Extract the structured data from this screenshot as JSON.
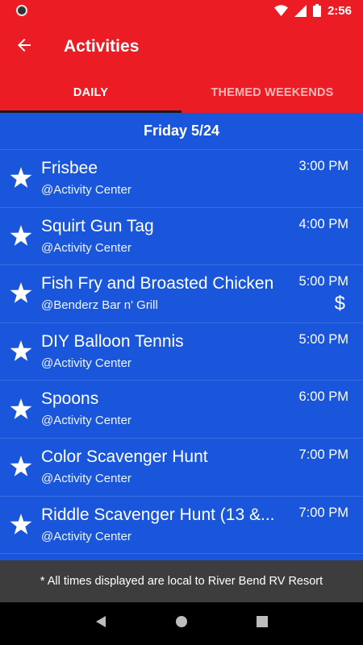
{
  "status_bar": {
    "time": "2:56",
    "icons": [
      "wifi-icon",
      "signal-icon",
      "battery-icon"
    ]
  },
  "app_bar": {
    "title": "Activities",
    "back_icon": "arrow-left-icon"
  },
  "tabs": [
    {
      "label": "DAILY",
      "active": true
    },
    {
      "label": "THEMED WEEKENDS",
      "active": false
    }
  ],
  "day_header": "Friday 5/24",
  "events": [
    {
      "name": "Frisbee",
      "location": "@Activity Center",
      "time": "3:00 PM",
      "paid": false
    },
    {
      "name": "Squirt Gun Tag",
      "location": "@Activity Center",
      "time": "4:00 PM",
      "paid": false
    },
    {
      "name": "Fish Fry and Broasted Chicken",
      "location": "@Benderz Bar n' Grill",
      "time": "5:00 PM",
      "paid": true,
      "paid_symbol": "$"
    },
    {
      "name": "DIY Balloon Tennis",
      "location": "@Activity Center",
      "time": "5:00 PM",
      "paid": false
    },
    {
      "name": "Spoons",
      "location": "@Activity Center",
      "time": "6:00 PM",
      "paid": false
    },
    {
      "name": "Color Scavenger Hunt",
      "location": "@Activity Center",
      "time": "7:00 PM",
      "paid": false
    },
    {
      "name": "Riddle Scavenger Hunt (13 &...",
      "location": "@Activity Center",
      "time": "7:00 PM",
      "paid": false
    }
  ],
  "footer_note": "* All times displayed are local to River Bend RV Resort",
  "colors": {
    "primary_red": "#ec1c24",
    "list_blue": "#1a56db",
    "footer_gray": "#3d3d3d"
  }
}
